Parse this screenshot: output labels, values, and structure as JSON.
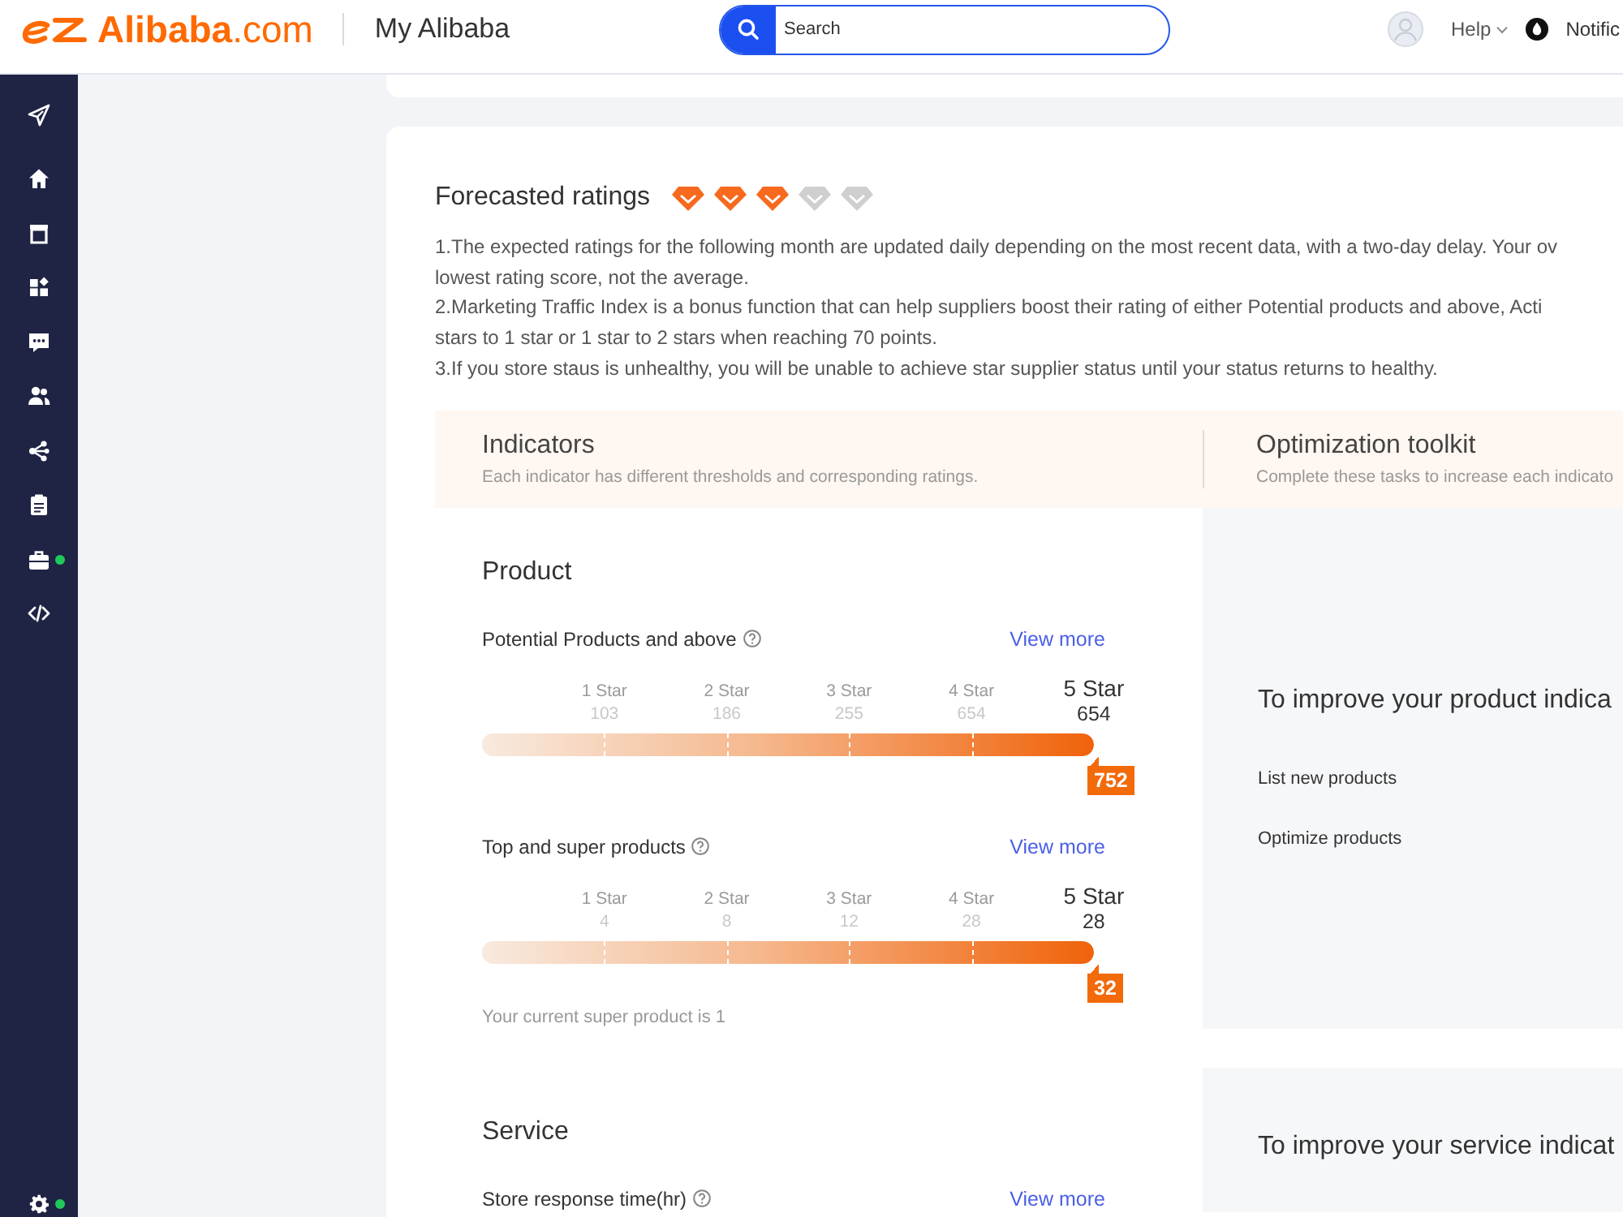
{
  "header": {
    "logo": "**Alibaba**.com",
    "title": "My Alibaba",
    "search": {
      "placeholder": "Search"
    },
    "help": "Help",
    "notifications": "Notific"
  },
  "sidebar": {
    "items": [
      {
        "notice": false
      },
      {
        "notice": false
      },
      {
        "notice": false
      },
      {
        "notice": false
      },
      {
        "notice": false
      },
      {
        "notice": false
      },
      {
        "notice": false
      },
      {
        "notice": false
      },
      {
        "notice": true
      },
      {
        "notice": false
      }
    ],
    "footer": {
      "notice": true
    }
  },
  "forecast": {
    "title": "Forecasted ratings",
    "diamonds": [
      {
        "filled": true
      },
      {
        "filled": true
      },
      {
        "filled": true
      },
      {
        "filled": false
      },
      {
        "filled": false
      }
    ],
    "notes": [
      "1.The expected ratings for the following month are updated daily depending on the most recent data, with a two-day delay. Your ov",
      "lowest rating score, not the average.",
      "2.Marketing Traffic Index is a bonus function that can help suppliers boost their rating of either Potential products and above, Acti",
      "stars to 1 star or 1 star to 2 stars when reaching 70 points.",
      "3.If you store staus is unhealthy, you will be unable to achieve star supplier status until your status returns to healthy."
    ]
  },
  "indicators": {
    "title": "Indicators",
    "subtitle": "Each indicator has different thresholds and corresponding ratings."
  },
  "toolkit": {
    "title": "Optimization toolkit",
    "subtitle": "Complete these tasks to increase each indicato"
  },
  "sections": [
    {
      "title": "Product",
      "metrics": [
        {
          "label": "Potential Products and above",
          "link": "View more",
          "tiers": [
            {
              "label": "1 Star",
              "value": "103",
              "selected": false
            },
            {
              "label": "2 Star",
              "value": "186",
              "selected": false
            },
            {
              "label": "3 Star",
              "value": "255",
              "selected": false
            },
            {
              "label": "4 Star",
              "value": "654",
              "selected": false
            },
            {
              "label": "5 Star",
              "value": "654",
              "selected": true
            }
          ],
          "level": 1,
          "badge": "752"
        },
        {
          "label": "Top and super products",
          "link": "View more",
          "tiers": [
            {
              "label": "1 Star",
              "value": "4",
              "selected": false
            },
            {
              "label": "2 Star",
              "value": "8",
              "selected": false
            },
            {
              "label": "3 Star",
              "value": "12",
              "selected": false
            },
            {
              "label": "4 Star",
              "value": "28",
              "selected": false
            },
            {
              "label": "5 Star",
              "value": "28",
              "selected": true
            }
          ],
          "level": 1,
          "badge": "32",
          "note": "Your current super product is 1"
        }
      ],
      "panel": {
        "heading": "To improve your product indica",
        "tasks": [
          "List new products",
          "Optimize products"
        ]
      }
    },
    {
      "title": "Service",
      "metrics": [
        {
          "label": "Store response time(hr)",
          "link": "View more"
        }
      ],
      "panel": {
        "heading": "To improve your service indicat"
      }
    }
  ]
}
